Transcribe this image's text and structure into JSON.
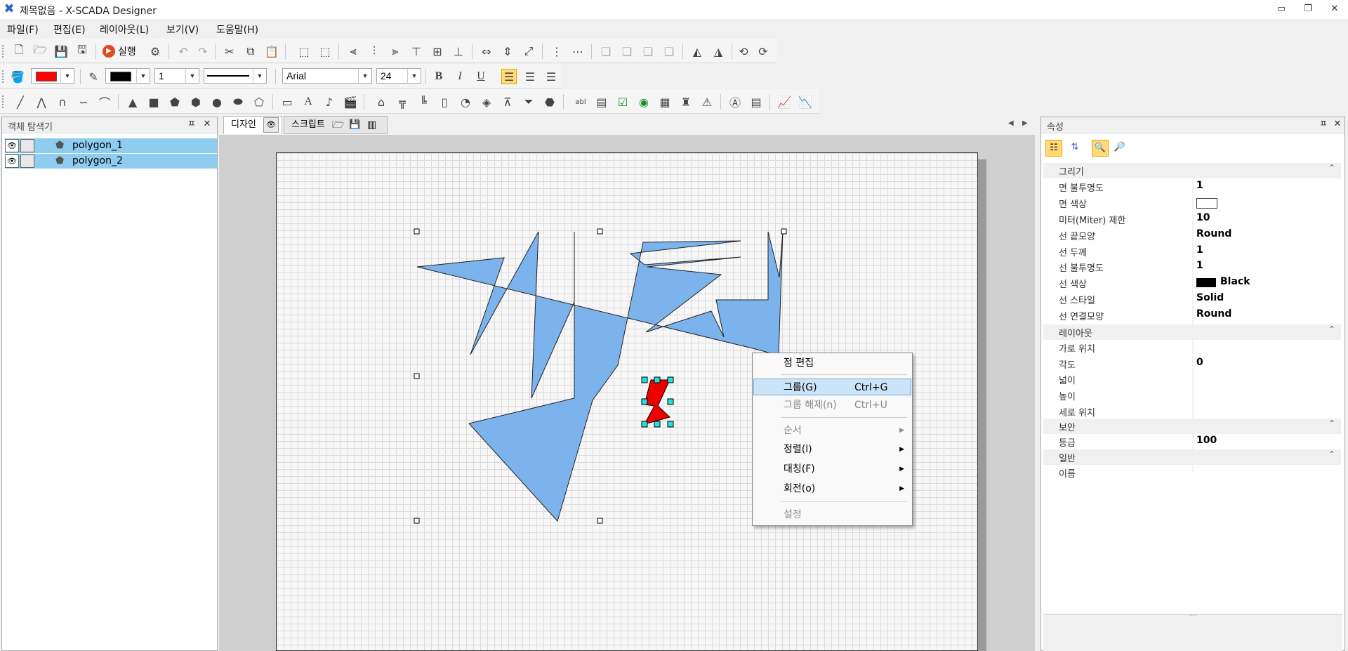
{
  "window": {
    "title": "제목없음 - X-SCADA Designer",
    "buttons": {
      "minimize": "▭",
      "restore": "❐",
      "close": "✕"
    }
  },
  "menu": [
    "파일(F)",
    "편집(E)",
    "레이아웃(L)",
    "보기(V)",
    "도움말(H)"
  ],
  "toolbar1": {
    "run_label": "실행"
  },
  "toolbar2": {
    "fill_color": "#ff0000",
    "line_color": "#000000",
    "line_width": "1",
    "font_name": "Arial",
    "font_size": "24",
    "bold": "B",
    "italic": "I",
    "underline": "U"
  },
  "explorer": {
    "title": "객체 탐색기",
    "items": [
      {
        "label": "polygon_1"
      },
      {
        "label": "polygon_2"
      }
    ]
  },
  "tabs": {
    "design": "디자인",
    "script": "스크립트"
  },
  "context_menu": {
    "items": [
      {
        "label": "점 편집",
        "shortcut": "",
        "enabled": true,
        "submenu": false
      },
      {
        "label": "그룹(G)",
        "shortcut": "Ctrl+G",
        "enabled": true,
        "submenu": false,
        "highlighted": true
      },
      {
        "label": "그룹 해제(n)",
        "shortcut": "Ctrl+U",
        "enabled": false,
        "submenu": false
      },
      {
        "label": "순서",
        "shortcut": "",
        "enabled": false,
        "submenu": true
      },
      {
        "label": "정렬(l)",
        "shortcut": "",
        "enabled": true,
        "submenu": true
      },
      {
        "label": "대칭(F)",
        "shortcut": "",
        "enabled": true,
        "submenu": true
      },
      {
        "label": "회전(o)",
        "shortcut": "",
        "enabled": true,
        "submenu": true
      },
      {
        "label": "설정",
        "shortcut": "",
        "enabled": false,
        "submenu": false
      }
    ]
  },
  "properties": {
    "title": "속성",
    "categories": [
      {
        "name": "그리기",
        "rows": [
          {
            "name": "면 불투명도",
            "value": "1"
          },
          {
            "name": "면 색상",
            "value": ""
          },
          {
            "name": "미터(Miter) 제한",
            "value": "10"
          },
          {
            "name": "선 끝모양",
            "value": "Round"
          },
          {
            "name": "선 두께",
            "value": "1"
          },
          {
            "name": "선 불투명도",
            "value": "1"
          },
          {
            "name": "선 색상",
            "value": "Black"
          },
          {
            "name": "선 스타일",
            "value": "Solid"
          },
          {
            "name": "선 연결모양",
            "value": "Round"
          }
        ]
      },
      {
        "name": "레이아웃",
        "rows": [
          {
            "name": "가로 위치",
            "value": ""
          },
          {
            "name": "각도",
            "value": "0"
          },
          {
            "name": "넓이",
            "value": ""
          },
          {
            "name": "높이",
            "value": ""
          },
          {
            "name": "세로 위치",
            "value": ""
          }
        ]
      },
      {
        "name": "보안",
        "rows": [
          {
            "name": "등급",
            "value": "100"
          }
        ]
      },
      {
        "name": "일반",
        "rows": [
          {
            "name": "이름",
            "value": ""
          }
        ]
      }
    ]
  },
  "colors": {
    "polygon_fill": "#7db3ec",
    "selected_fill": "#ee0000",
    "highlight": "#cce4f7",
    "selection": "#8fcdf0"
  }
}
